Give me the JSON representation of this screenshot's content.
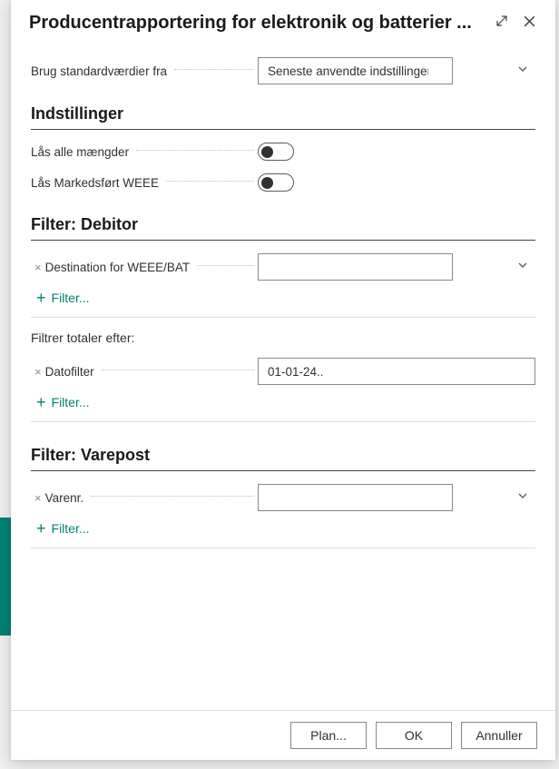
{
  "header": {
    "title": "Producentrapportering for elektronik og batterier ..."
  },
  "default_row": {
    "label": "Brug standardværdier fra",
    "value": "Seneste anvendte indstillinger og filtre"
  },
  "settings": {
    "title": "Indstillinger",
    "lock_all_qty": {
      "label": "Lås alle mængder",
      "on": false
    },
    "lock_marketed_weee": {
      "label": "Lås Markedsført WEEE",
      "on": false
    }
  },
  "filter_debitor": {
    "title": "Filter: Debitor",
    "dest": {
      "label": "Destination for WEEE/BAT",
      "value": ""
    },
    "add_filter": "Filter..."
  },
  "filter_totals": {
    "heading": "Filtrer totaler efter:",
    "date": {
      "label": "Datofilter",
      "value": "01-01-24.."
    },
    "add_filter": "Filter..."
  },
  "filter_varepost": {
    "title": "Filter: Varepost",
    "item": {
      "label": "Varenr.",
      "value": ""
    },
    "add_filter": "Filter..."
  },
  "footer": {
    "plan": "Plan...",
    "ok": "OK",
    "cancel": "Annuller"
  }
}
